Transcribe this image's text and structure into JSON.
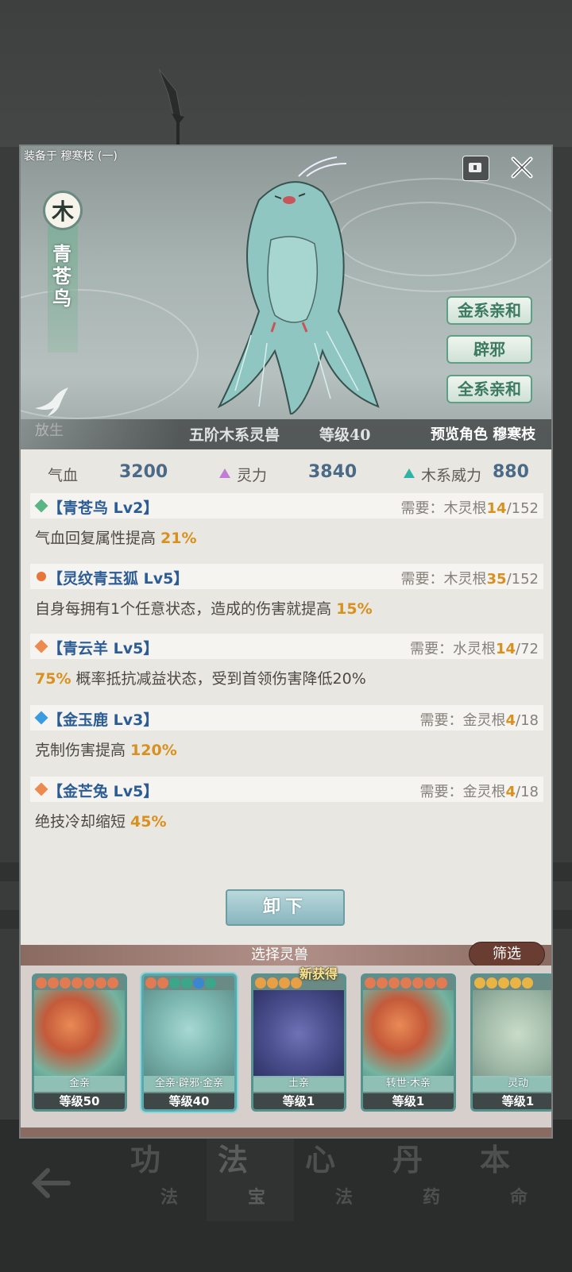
{
  "header": {
    "equipped_text": "装备于 穆寒枝 (一)",
    "element": "木",
    "beast_name": "青苍鸟",
    "release_label": "放生",
    "tags": [
      "金系亲和",
      "辟邪",
      "全系亲和"
    ],
    "rank_text": "五阶木系灵兽",
    "level_text": "等级40",
    "preview_text": "预览角色 穆寒枝"
  },
  "stats": [
    {
      "label": "气血",
      "value": "3200"
    },
    {
      "label": "灵力",
      "value": "3840"
    },
    {
      "label": "木系威力",
      "value": "880"
    }
  ],
  "skills": [
    {
      "name": "【青苍鸟 Lv2】",
      "req_prefix": "需要：木灵根",
      "req_cur": "14",
      "req_max": "/152",
      "desc_pre": "气血回复属性提高 ",
      "desc_hl": "21%",
      "desc_post": "",
      "icon_color": "#58b684"
    },
    {
      "name": "【灵纹青玉狐 Lv5】",
      "req_prefix": "需要：木灵根",
      "req_cur": "35",
      "req_max": "/152",
      "desc_pre": "自身每拥有1个任意状态，造成的伤害就提高 ",
      "desc_hl": "15%",
      "desc_post": "",
      "icon_color": "#e8763a"
    },
    {
      "name": "【青云羊 Lv5】",
      "req_prefix": "需要：水灵根",
      "req_cur": "14",
      "req_max": "/72",
      "desc_pre": "",
      "desc_hl": "75%",
      "desc_post": " 概率抵抗减益状态，受到首领伤害降低20%",
      "icon_color": "#ee8a50"
    },
    {
      "name": "【金玉鹿 Lv3】",
      "req_prefix": "需要：金灵根",
      "req_cur": "4",
      "req_max": "/18",
      "desc_pre": "克制伤害提高 ",
      "desc_hl": "120%",
      "desc_post": "",
      "icon_color": "#3a9be0"
    },
    {
      "name": "【金芒兔 Lv5】",
      "req_prefix": "需要：金灵根",
      "req_cur": "4",
      "req_max": "/18",
      "desc_pre": "绝技冷却缩短 ",
      "desc_hl": "45%",
      "desc_post": "",
      "icon_color": "#ee8a50"
    }
  ],
  "unequip_label": "卸下",
  "select_title": "选择灵兽",
  "filter_label": "筛选",
  "new_tag": "新获得",
  "cards": [
    {
      "ribbon": "金亲",
      "level": "等级50"
    },
    {
      "ribbon": "全亲·辟邪·金亲",
      "level": "等级40"
    },
    {
      "ribbon": "土亲",
      "level": "等级1"
    },
    {
      "ribbon": "转世·木亲",
      "level": "等级1"
    },
    {
      "ribbon": "灵动",
      "level": "等级1"
    }
  ],
  "nav": [
    {
      "big": "功",
      "small": "法"
    },
    {
      "big": "法",
      "small": "宝"
    },
    {
      "big": "心",
      "small": "法"
    },
    {
      "big": "丹",
      "small": "药"
    },
    {
      "big": "本",
      "small": "命"
    }
  ],
  "colors": {
    "accent": "#d9901e",
    "skill_name": "#2c5c94",
    "stat_value": "#4a6a88"
  }
}
